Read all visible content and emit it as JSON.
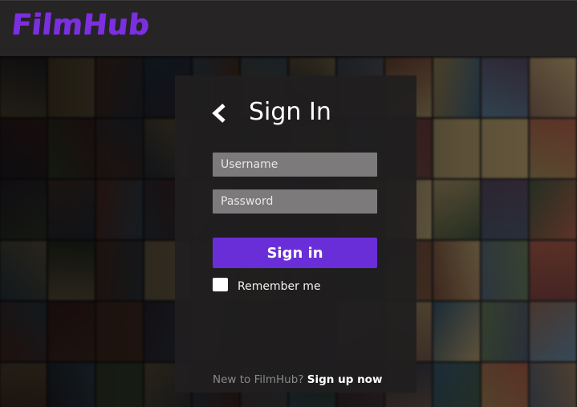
{
  "brand": {
    "name": "FilmHub",
    "color": "#7b2fe0"
  },
  "login": {
    "title": "Sign In",
    "back_icon": "chevron-left-icon",
    "username_placeholder": "Username",
    "username_value": "",
    "password_placeholder": "Password",
    "password_value": "",
    "submit_label": "Sign in",
    "remember_label": "Remember me",
    "remember_checked": false,
    "signup_prompt": "New to FilmHub?",
    "signup_link": "Sign up now"
  },
  "colors": {
    "accent": "#6a2ed9",
    "panel": "#201e1f",
    "header": "#262425"
  }
}
